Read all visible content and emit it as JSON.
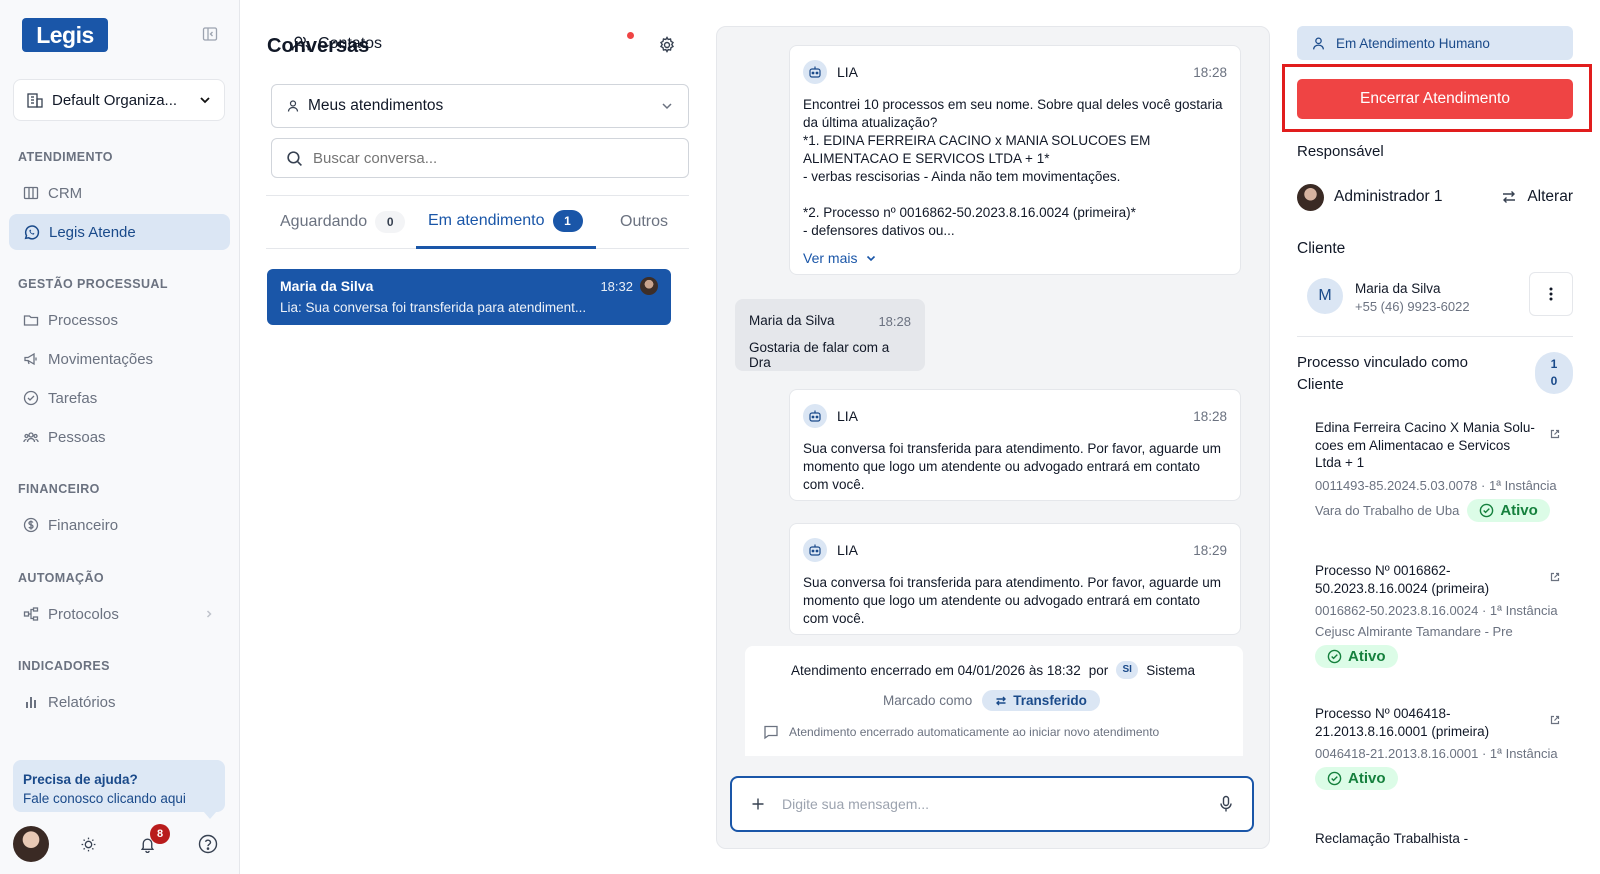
{
  "brand": {
    "logo": "Legis"
  },
  "org": {
    "label": "Default Organiza..."
  },
  "sidebar": {
    "sections": [
      {
        "title": "ATENDIMENTO"
      },
      {
        "title": "GESTÃO PROCESSUAL"
      },
      {
        "title": "FINANCEIRO"
      },
      {
        "title": "AUTOMAÇÃO"
      },
      {
        "title": "INDICADORES"
      }
    ],
    "items": [
      {
        "label": "CRM",
        "icon": "kanban-icon"
      },
      {
        "label": "Legis Atende",
        "icon": "whatsapp-icon"
      },
      {
        "label": "Processos",
        "icon": "folder-icon"
      },
      {
        "label": "Movimentações",
        "icon": "megaphone-icon"
      },
      {
        "label": "Tarefas",
        "icon": "check-circle-icon"
      },
      {
        "label": "Pessoas",
        "icon": "people-icon"
      },
      {
        "label": "Financeiro",
        "icon": "dollar-icon"
      },
      {
        "label": "Protocolos",
        "icon": "workflow-icon"
      },
      {
        "label": "Relatórios",
        "icon": "bar-chart-icon"
      }
    ],
    "help": {
      "title": "Precisa de ajuda?",
      "link": "Fale conosco clicando aqui"
    },
    "notifications_count": "8"
  },
  "conversations": {
    "title": "Conversas",
    "contacts_label": "Contatos",
    "filter": "Meus atendimentos",
    "search_placeholder": "Buscar conversa...",
    "tabs": [
      {
        "label": "Aguardando",
        "count": "0"
      },
      {
        "label": "Em atendimento",
        "count": "1"
      },
      {
        "label": "Outros"
      }
    ],
    "items": [
      {
        "name": "Maria da Silva",
        "time": "18:32",
        "preview": "Lia: Sua conversa foi transferida para atendiment..."
      }
    ]
  },
  "chat": {
    "messages": [
      {
        "sender": "LIA",
        "time": "18:28",
        "text": "Encontrei 10 processos em seu nome. Sobre qual deles você gostaria da última atualização?\n*1. EDINA FERREIRA CACINO x MANIA SOLUCOES EM ALIMENTACAO E SERVICOS LTDA + 1*\n- verbas rescisorias  - Ainda não tem movimentações.\n\n*2. Processo nº 0016862-50.2023.8.16.0024 (primeira)*\n- defensores dativos ou...",
        "more": "Ver mais"
      },
      {
        "sender": "Maria da Silva",
        "time": "18:28",
        "text": "Gostaria de falar com a Dra"
      },
      {
        "sender": "LIA",
        "time": "18:28",
        "text": "Sua conversa foi transferida para atendimento. Por favor, aguarde um momento que logo um atendente ou advogado entrará em contato com você."
      },
      {
        "sender": "LIA",
        "time": "18:29",
        "text": "Sua conversa foi transferida para atendimento. Por favor, aguarde um momento que logo um atendente ou advogado entrará em contato com você."
      }
    ],
    "system": {
      "closed": "Atendimento encerrado em 04/01/2026 às 18:32",
      "by": "por",
      "initials": "SI",
      "actor": "Sistema",
      "marked_as": "Marcado como",
      "tag": "Transferido",
      "note": "Atendimento encerrado automaticamente ao iniciar novo atendimento"
    },
    "input_placeholder": "Digite sua mensagem..."
  },
  "details": {
    "status": "Em Atendimento Humano",
    "end_button": "Encerrar Atendimento",
    "responsible_label": "Responsável",
    "responsible_name": "Administrador 1",
    "change_label": "Alterar",
    "client_label": "Cliente",
    "client_initial": "M",
    "client_name": "Maria da Silva",
    "client_phone": "+55 (46) 9923-6022",
    "process_title": "Processo vinculado como Cliente",
    "process_count_a": "1",
    "process_count_b": "0",
    "processes": [
      {
        "title": "Edina Ferreira Cacino X Mania Solu-coes em Alimentacao e Servicos Ltda + 1",
        "number": "0011493-85.2024.5.03.0078 · 1ª Instância",
        "court": "Vara do Trabalho de Uba",
        "status": "Ativo"
      },
      {
        "title": "Processo Nº 0016862-50.2023.8.16.0024 (primeira)",
        "number": "0016862-50.2023.8.16.0024 · 1ª Instância",
        "court": "Cejusc Almirante Tamandare - Pre",
        "status": "Ativo"
      },
      {
        "title": "Processo Nº 0046418-21.2013.8.16.0001 (primeira)",
        "number": "0046418-21.2013.8.16.0001 · 1ª Instância",
        "court": "",
        "status": "Ativo"
      },
      {
        "title": "Reclamação Trabalhista -"
      }
    ]
  },
  "colors": {
    "primary": "#1a56a8",
    "danger": "#ef4444",
    "success": "#15803d",
    "highlight": "#e11d1d"
  }
}
